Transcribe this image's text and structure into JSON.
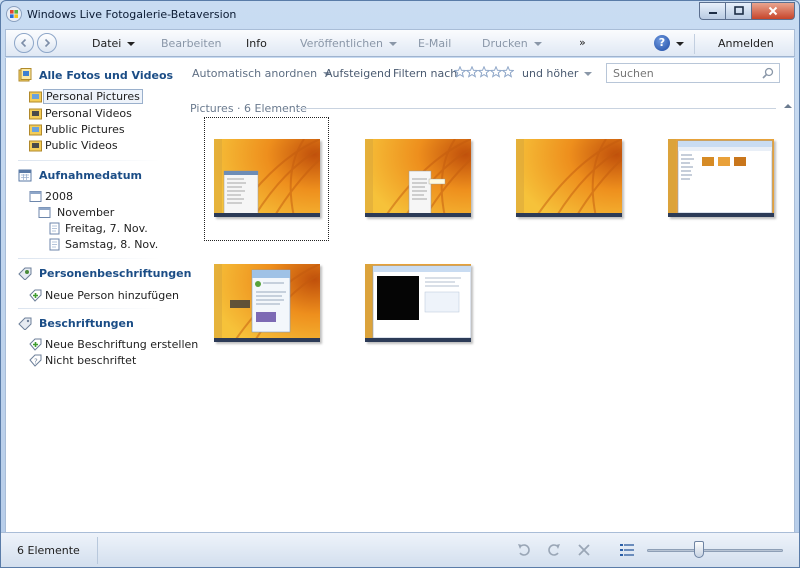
{
  "window": {
    "title": "Windows Live Fotogalerie-Betaversion"
  },
  "toolbar": {
    "datei": "Datei",
    "bearbeiten": "Bearbeiten",
    "info": "Info",
    "veroeffentlichen": "Veröffentlichen",
    "email": "E-Mail",
    "drucken": "Drucken",
    "more": "»",
    "anmelden": "Anmelden"
  },
  "sidebar": {
    "all_title": "Alle Fotos und Videos",
    "folders": [
      {
        "label": "Personal Pictures",
        "selected": true
      },
      {
        "label": "Personal Videos"
      },
      {
        "label": "Public Pictures"
      },
      {
        "label": "Public Videos"
      }
    ],
    "date_title": "Aufnahmedatum",
    "year": "2008",
    "month": "November",
    "days": [
      "Freitag, 7. Nov.",
      "Samstag, 8. Nov."
    ],
    "people_title": "Personenbeschriftungen",
    "add_person": "Neue Person hinzufügen",
    "tags_title": "Beschriftungen",
    "new_tag": "Neue Beschriftung erstellen",
    "untagged": "Nicht beschriftet"
  },
  "filter": {
    "arrange": "Automatisch anordnen",
    "sort": "Aufsteigend",
    "filter_by": "Filtern nach",
    "rating": "und höher",
    "search_placeholder": "Suchen"
  },
  "group": {
    "header": "Pictures · 6 Elemente"
  },
  "thumbnails": [
    {
      "kind": "desktop-menu",
      "selected": true
    },
    {
      "kind": "desktop-menu-tooltip"
    },
    {
      "kind": "desktop-plain"
    },
    {
      "kind": "explorer-window"
    },
    {
      "kind": "messenger-window"
    },
    {
      "kind": "black-video-window"
    }
  ],
  "status": {
    "count": "6 Elemente",
    "zoom_level": 0.38
  },
  "colors": {
    "accent": "#1b4d86",
    "orange": "#e48a18"
  }
}
